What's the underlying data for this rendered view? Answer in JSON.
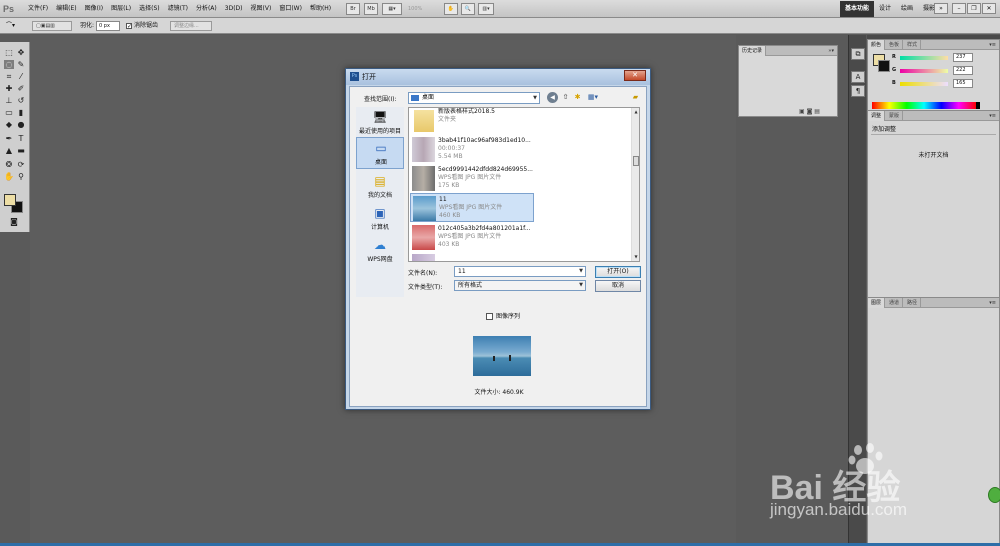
{
  "app": {
    "logo": "Ps",
    "menu": [
      "文件(F)",
      "编辑(E)",
      "图像(I)",
      "图层(L)",
      "选择(S)",
      "滤镜(T)",
      "分析(A)",
      "3D(D)",
      "视图(V)",
      "窗口(W)",
      "帮助(H)"
    ],
    "zoom": "100%",
    "workspaces": [
      "基本功能",
      "设计",
      "绘画",
      "摄影"
    ],
    "active_workspace": "基本功能"
  },
  "options": {
    "feather_label": "羽化:",
    "feather_value": "0 px",
    "antialias_label": "消除锯齿",
    "refine_edge": "调整边缘..."
  },
  "tools": {
    "foreground_color": "#eddea5",
    "background_color": "#111111"
  },
  "panels": {
    "history_tab": "历史记录",
    "color_tabs": [
      "颜色",
      "色板",
      "样式"
    ],
    "color_rgb": [
      {
        "label": "R",
        "value": "237"
      },
      {
        "label": "G",
        "value": "222"
      },
      {
        "label": "B",
        "value": "165"
      }
    ],
    "adjust_tabs": [
      "调整",
      "蒙版"
    ],
    "adjust_title": "添加调整",
    "adjust_msg": "未打开文档",
    "layers_tabs": [
      "图层",
      "通道",
      "路径"
    ]
  },
  "dialog": {
    "title": "打开",
    "look_in_label": "查找范围(I):",
    "look_in_value": "桌面",
    "places": [
      {
        "label": "最近使用的项目",
        "icon": "recent-icon"
      },
      {
        "label": "桌面",
        "icon": "desktop-icon"
      },
      {
        "label": "我的文档",
        "icon": "documents-icon"
      },
      {
        "label": "计算机",
        "icon": "computer-icon"
      },
      {
        "label": "WPS网盘",
        "icon": "cloud-icon"
      }
    ],
    "files": [
      {
        "name": "新版表格样式2018.5",
        "meta1": "文件夹",
        "meta2": ""
      },
      {
        "name": "3bab41f10ac96af983d1ed10...",
        "meta1": "00:00:37",
        "meta2": "5.54 MB"
      },
      {
        "name": "5ecd9991442dfdd824d69955...",
        "meta1": "WPS看图 JPG 图片文件",
        "meta2": "175 KB"
      },
      {
        "name": "11",
        "meta1": "WPS看图 JPG 图片文件",
        "meta2": "460 KB"
      },
      {
        "name": "012c405a3b2fd4a801201a1f...",
        "meta1": "WPS看图 JPG 图片文件",
        "meta2": "403 KB"
      }
    ],
    "selected_file": 3,
    "filename_label": "文件名(N):",
    "filename_value": "11",
    "filetype_label": "文件类型(T):",
    "filetype_value": "所有格式",
    "open_button": "打开(O)",
    "cancel_button": "取消",
    "image_sequence": "图像序列",
    "file_size": "文件大小: 460.9K"
  },
  "watermark": {
    "logo": "Bai  经验",
    "url": "jingyan.baidu.com"
  }
}
